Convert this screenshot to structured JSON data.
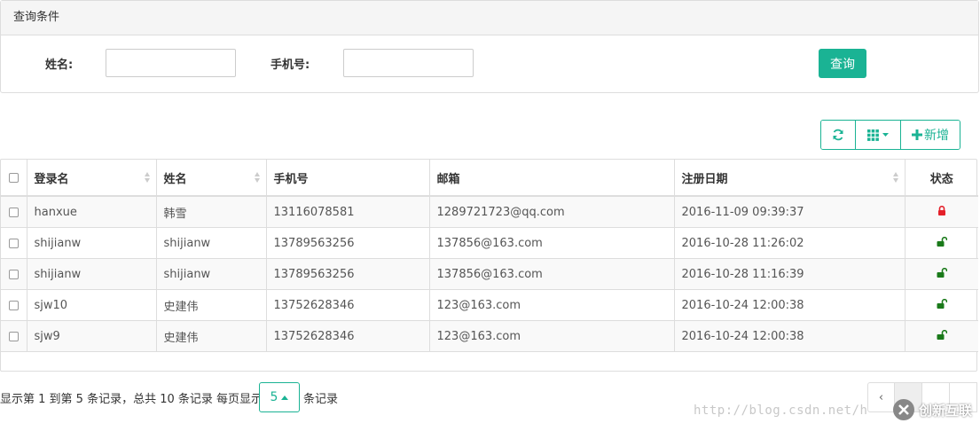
{
  "query": {
    "panel_title": "查询条件",
    "name_label": "姓名:",
    "name_value": "",
    "phone_label": "手机号:",
    "phone_value": "",
    "search_button": "查询"
  },
  "toolbar": {
    "refresh_icon": "refresh-icon",
    "columns_icon": "grid-icon",
    "add_label": "新增"
  },
  "table": {
    "headers": [
      "登录名",
      "姓名",
      "手机号",
      "邮箱",
      "注册日期",
      "状态"
    ],
    "rows": [
      {
        "login": "hanxue",
        "name": "韩雪",
        "phone": "13116078581",
        "email": "1289721723@qq.com",
        "date": "2016-11-09 09:39:37",
        "status": "locked"
      },
      {
        "login": "shijianw",
        "name": "shijianw",
        "phone": "13789563256",
        "email": "137856@163.com",
        "date": "2016-10-28 11:26:02",
        "status": "unlocked"
      },
      {
        "login": "shijianw",
        "name": "shijianw",
        "phone": "13789563256",
        "email": "137856@163.com",
        "date": "2016-10-28 11:16:39",
        "status": "unlocked"
      },
      {
        "login": "sjw10",
        "name": "史建伟",
        "phone": "13752628346",
        "email": "123@163.com",
        "date": "2016-10-24 12:00:38",
        "status": "unlocked"
      },
      {
        "login": "sjw9",
        "name": "史建伟",
        "phone": "13752628346",
        "email": "123@163.com",
        "date": "2016-10-24 12:00:38",
        "status": "unlocked"
      }
    ]
  },
  "footer": {
    "summary": "显示第 1 到第 5 条记录，总共 10 条记录 每页显示",
    "page_size": "5",
    "suffix": "条记录",
    "prev": "‹"
  },
  "watermark": {
    "url": "http://blog.csdn.net/h",
    "brand": "创新互联"
  },
  "colors": {
    "accent": "#1ab394",
    "locked": "#e4202a",
    "unlocked": "#1a7a1a"
  }
}
